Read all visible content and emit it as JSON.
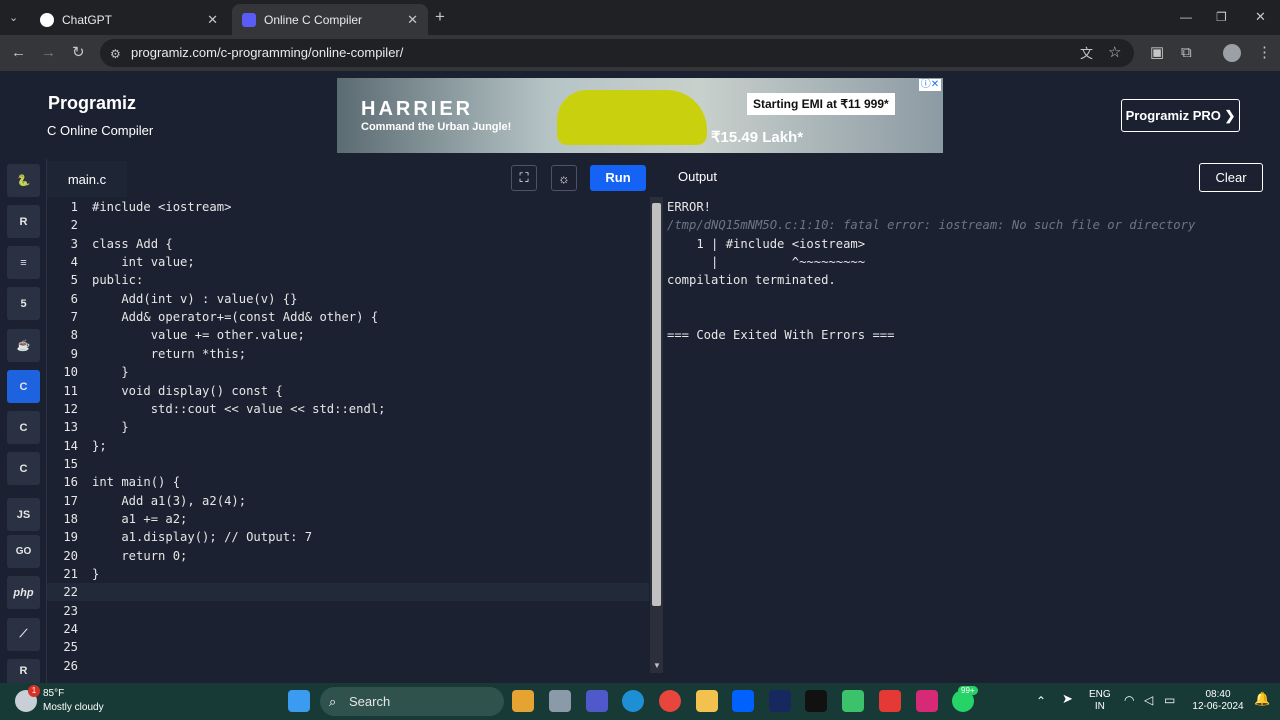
{
  "browser": {
    "tabs": [
      {
        "label": "ChatGPT",
        "active": false
      },
      {
        "label": "Online C Compiler",
        "active": true
      }
    ],
    "url": "programiz.com/c-programming/online-compiler/"
  },
  "site": {
    "logo": "Programiz",
    "subtitle": "C Online Compiler",
    "pro_button": "Programiz PRO ❯"
  },
  "ad": {
    "brand": "HARRIER",
    "tagline": "Command the Urban Jungle!",
    "emi": "Starting EMI at ₹11 999*",
    "price": "₹15.49 Lakh*"
  },
  "sidebar": {
    "languages": [
      {
        "name": "python",
        "glyph": "🐍"
      },
      {
        "name": "r",
        "glyph": "R"
      },
      {
        "name": "sql",
        "glyph": "≡"
      },
      {
        "name": "html",
        "glyph": "5"
      },
      {
        "name": "java",
        "glyph": "☕"
      },
      {
        "name": "c",
        "glyph": "C",
        "active": true
      },
      {
        "name": "cpp",
        "glyph": "C"
      },
      {
        "name": "csharp",
        "glyph": "C"
      },
      {
        "name": "javascript",
        "glyph": "JS"
      },
      {
        "name": "go",
        "glyph": "GO"
      },
      {
        "name": "php",
        "glyph": "php"
      },
      {
        "name": "swift",
        "glyph": "⟋"
      },
      {
        "name": "rust",
        "glyph": "R"
      }
    ]
  },
  "editor": {
    "filename": "main.c",
    "run_label": "Run",
    "lines": [
      "#include <iostream>",
      "",
      "class Add {",
      "    int value;",
      "public:",
      "    Add(int v) : value(v) {}",
      "    Add& operator+=(const Add& other) {",
      "        value += other.value;",
      "        return *this;",
      "    }",
      "    void display() const {",
      "        std::cout << value << std::endl;",
      "    }",
      "};",
      "",
      "int main() {",
      "    Add a1(3), a2(4);",
      "    a1 += a2;",
      "    a1.display(); // Output: 7",
      "    return 0;",
      "}",
      "",
      "",
      "",
      "",
      ""
    ]
  },
  "output": {
    "title": "Output",
    "clear_label": "Clear",
    "lines": [
      "ERROR!",
      "/tmp/dNQ15mNM5O.c:1:10: fatal error: iostream: No such file or directory",
      "    1 | #include <iostream>",
      "      |          ^~~~~~~~~~",
      "compilation terminated.",
      "",
      "",
      "=== Code Exited With Errors ==="
    ]
  },
  "taskbar": {
    "weather_temp": "85°F",
    "weather_desc": "Mostly cloudy",
    "weather_badge": "1",
    "search_label": "Search",
    "whatsapp_badge": "99+",
    "lang_top": "ENG",
    "lang_bottom": "IN",
    "time": "08:40",
    "date": "12-06-2024"
  }
}
